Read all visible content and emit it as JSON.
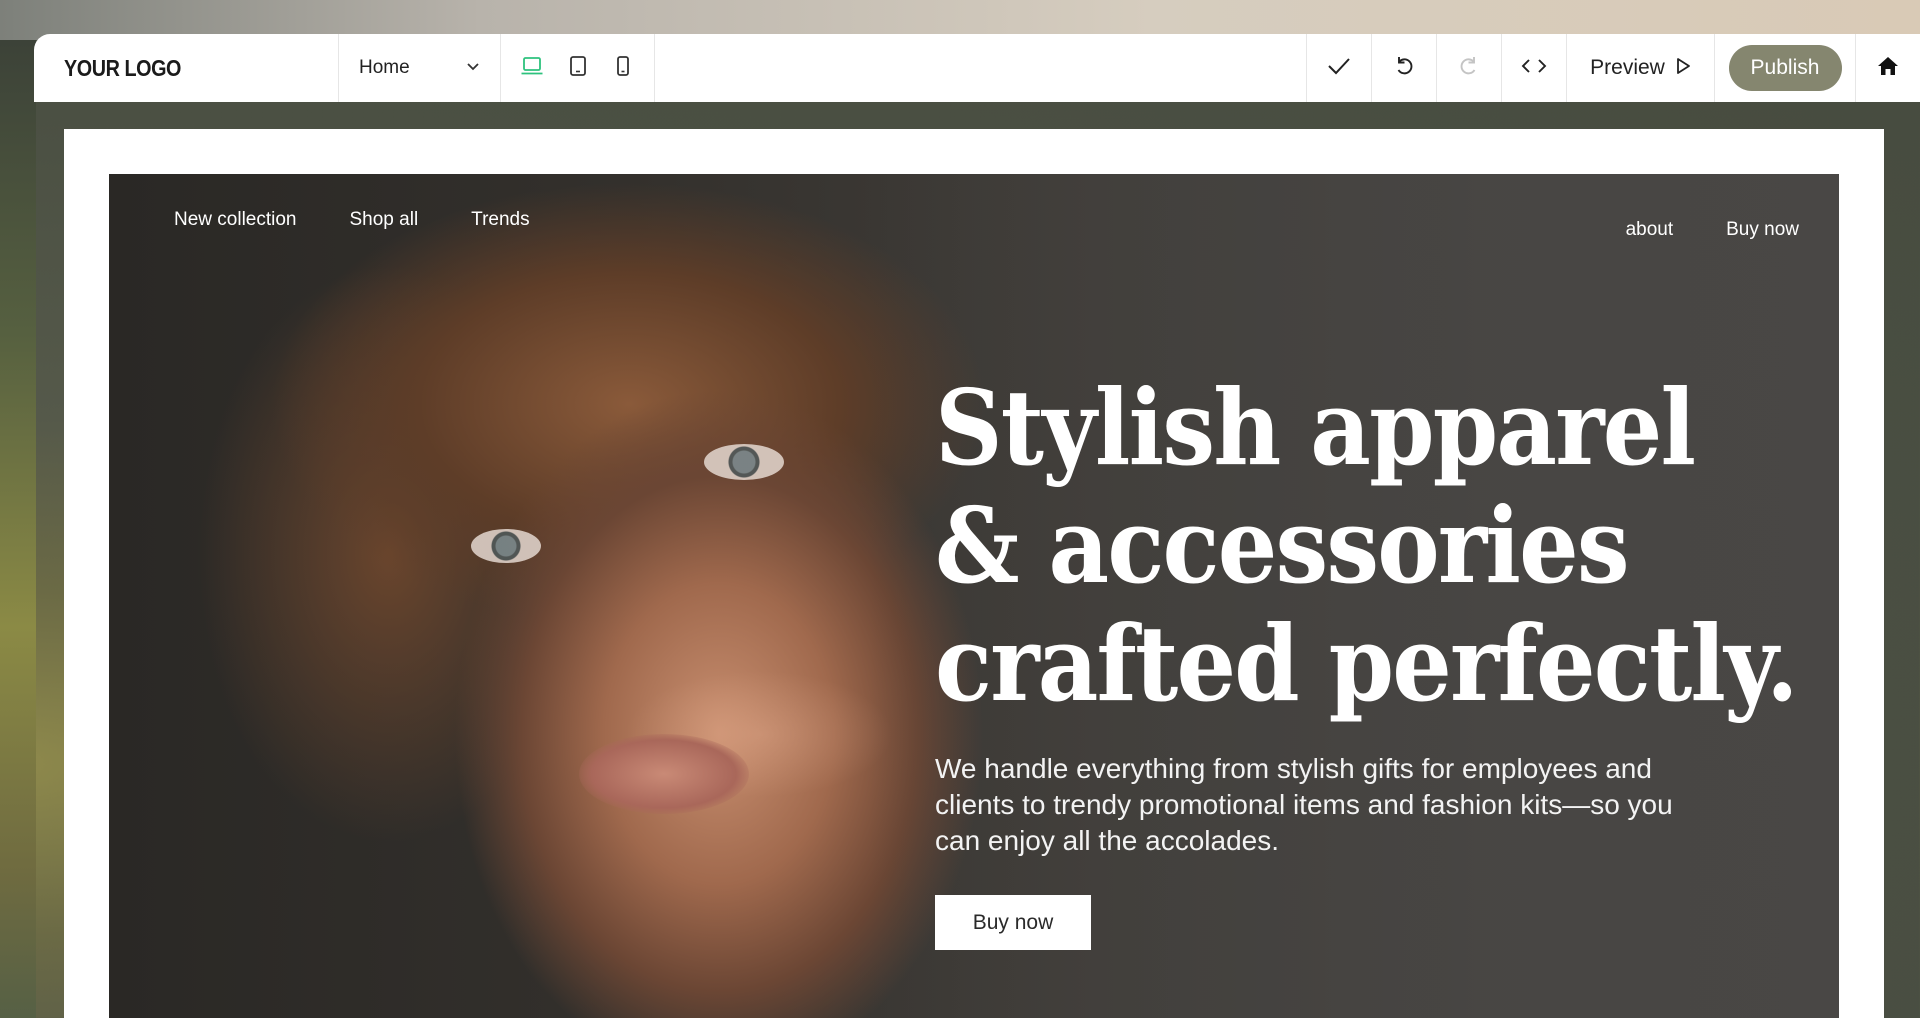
{
  "toolbar": {
    "logo": "YOUR LOGO",
    "page_select": {
      "selected": "Home"
    },
    "devices": [
      {
        "name": "desktop",
        "active": true
      },
      {
        "name": "tablet",
        "active": false
      },
      {
        "name": "mobile",
        "active": false
      }
    ],
    "actions": {
      "preview_label": "Preview",
      "publish_label": "Publish"
    },
    "colors": {
      "active_device": "#2ec27e",
      "publish_bg": "#85866f"
    }
  },
  "site": {
    "nav_left": [
      "New collection",
      "Shop all",
      "Trends"
    ],
    "nav_right": [
      "about",
      "Buy now"
    ],
    "hero": {
      "headline": [
        "Stylish apparel",
        "& accessories",
        "crafted perfectly."
      ],
      "subtext": "We handle everything from stylish gifts for employees and clients to trendy promotional items and fashion kits—so you can enjoy all the accolades.",
      "cta_label": "Buy now"
    }
  }
}
